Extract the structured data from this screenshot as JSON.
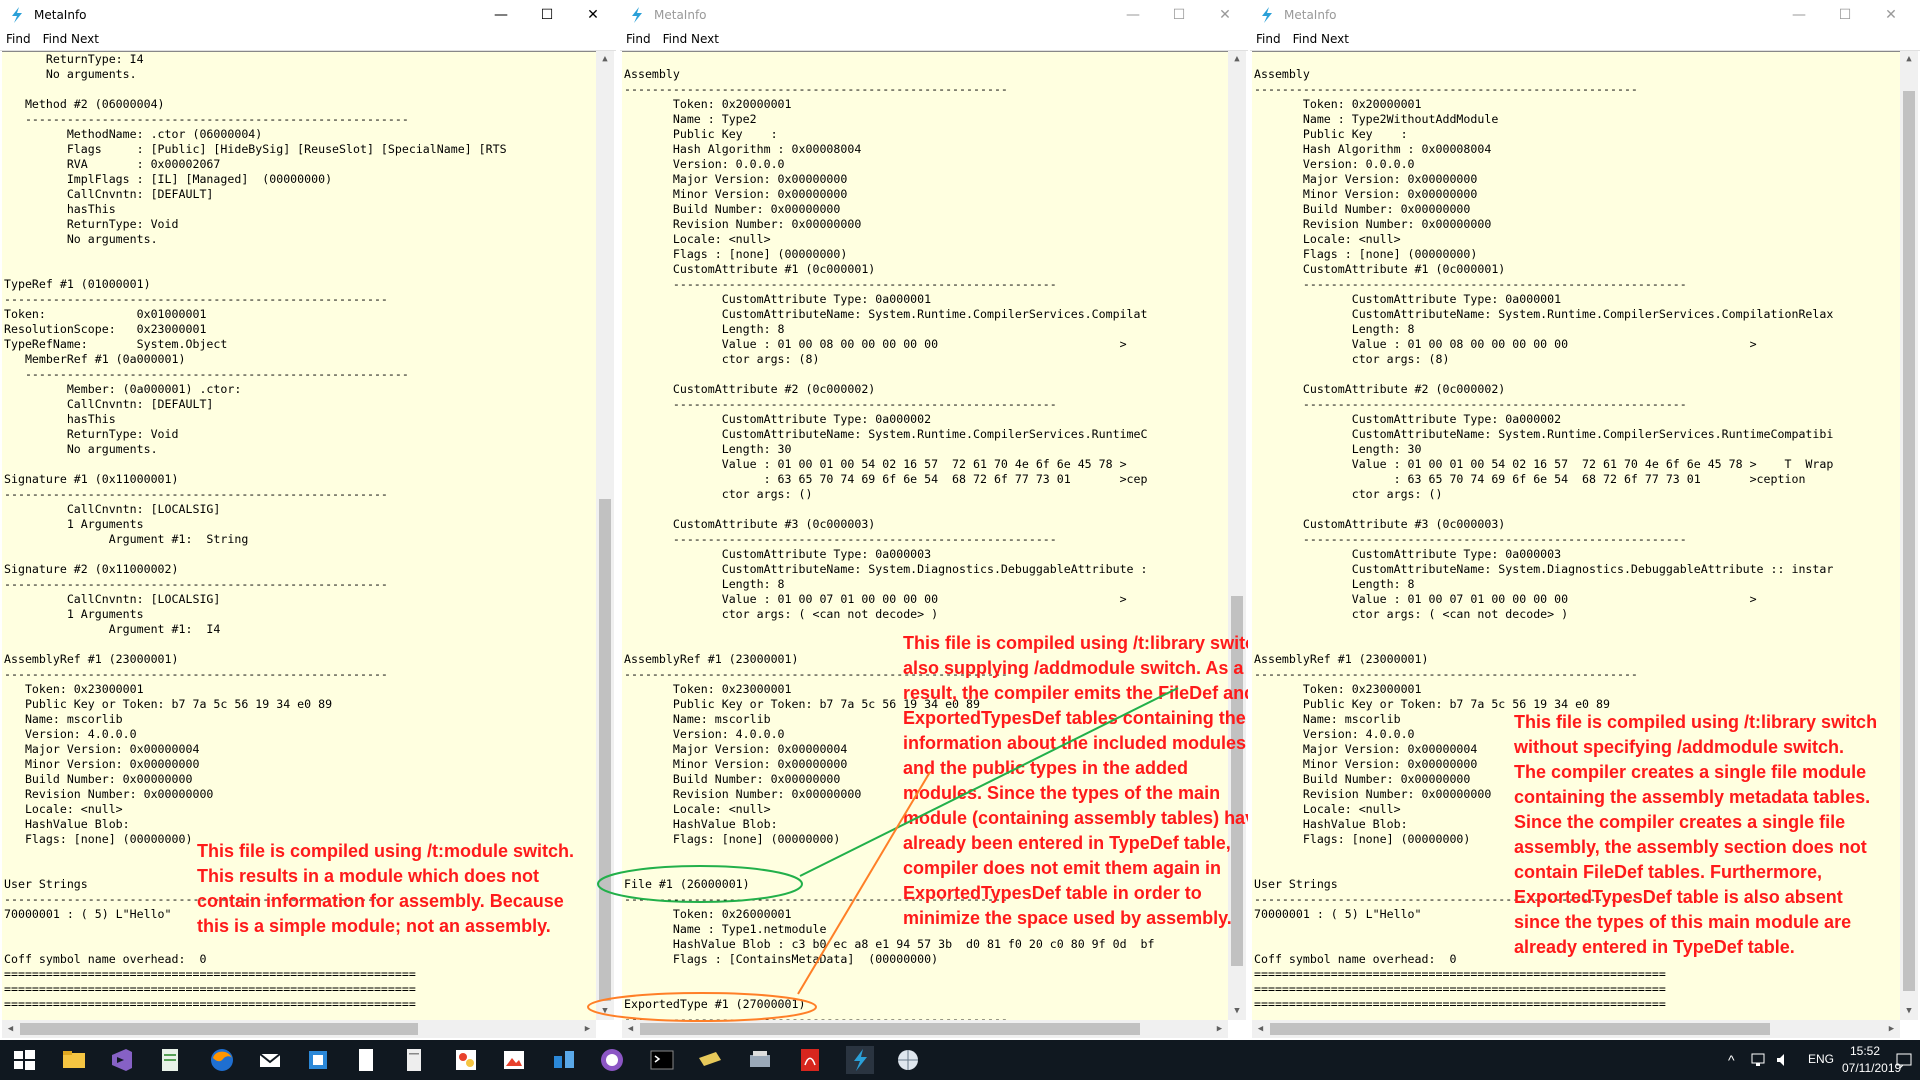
{
  "windows": [
    {
      "title": "MetaInfo",
      "menu": [
        "Find",
        "Find Next"
      ],
      "content": "      ReturnType: I4\n      No arguments.\n\n   Method #2 (06000004)\n   -------------------------------------------------------\n         MethodName: .ctor (06000004)\n         Flags     : [Public] [HideBySig] [ReuseSlot] [SpecialName] [RTS\n         RVA       : 0x00002067\n         ImplFlags : [IL] [Managed]  (00000000)\n         CallCnvntn: [DEFAULT]\n         hasThis\n         ReturnType: Void\n         No arguments.\n\n\nTypeRef #1 (01000001)\n-------------------------------------------------------\nToken:             0x01000001\nResolutionScope:   0x23000001\nTypeRefName:       System.Object\n   MemberRef #1 (0a000001)\n   -------------------------------------------------------\n         Member: (0a000001) .ctor:\n         CallCnvntn: [DEFAULT]\n         hasThis\n         ReturnType: Void\n         No arguments.\n\nSignature #1 (0x11000001)\n-------------------------------------------------------\n         CallCnvntn: [LOCALSIG]\n         1 Arguments\n               Argument #1:  String\n\nSignature #2 (0x11000002)\n-------------------------------------------------------\n         CallCnvntn: [LOCALSIG]\n         1 Arguments\n               Argument #1:  I4\n\nAssemblyRef #1 (23000001)\n-------------------------------------------------------\n   Token: 0x23000001\n   Public Key or Token: b7 7a 5c 56 19 34 e0 89\n   Name: mscorlib\n   Version: 4.0.0.0\n   Major Version: 0x00000004\n   Minor Version: 0x00000000\n   Build Number: 0x00000000\n   Revision Number: 0x00000000\n   Locale: <null>\n   HashValue Blob:\n   Flags: [none] (00000000)\n\n\nUser Strings\n-------------------------------------------------------\n70000001 : ( 5) L\"Hello\"\n\n\nCoff symbol name overhead:  0\n===========================================================\n===========================================================\n===========================================================",
      "annotation": "This file is compiled using /t:module switch.\nThis results in a module which does not\ncontain information for assembly. Because\nthis is a simple module; not an assembly."
    },
    {
      "title": "MetaInfo",
      "menu": [
        "Find",
        "Find Next"
      ],
      "content": "Assembly\n-------------------------------------------------------\n       Token: 0x20000001\n       Name : Type2\n       Public Key    :\n       Hash Algorithm : 0x00008004\n       Version: 0.0.0.0\n       Major Version: 0x00000000\n       Minor Version: 0x00000000\n       Build Number: 0x00000000\n       Revision Number: 0x00000000\n       Locale: <null>\n       Flags : [none] (00000000)\n       CustomAttribute #1 (0c000001)\n       -------------------------------------------------------\n              CustomAttribute Type: 0a000001\n              CustomAttributeName: System.Runtime.CompilerServices.Compilat\n              Length: 8\n              Value : 01 00 08 00 00 00 00 00                          >\n              ctor args: (8)\n\n       CustomAttribute #2 (0c000002)\n       -------------------------------------------------------\n              CustomAttribute Type: 0a000002\n              CustomAttributeName: System.Runtime.CompilerServices.RuntimeC\n              Length: 30\n              Value : 01 00 01 00 54 02 16 57  72 61 70 4e 6f 6e 45 78 >\n                    : 63 65 70 74 69 6f 6e 54  68 72 6f 77 73 01       >cep\n              ctor args: ()\n\n       CustomAttribute #3 (0c000003)\n       -------------------------------------------------------\n              CustomAttribute Type: 0a000003\n              CustomAttributeName: System.Diagnostics.DebuggableAttribute :\n              Length: 8\n              Value : 01 00 07 01 00 00 00 00                          >\n              ctor args: ( <can not decode> )\n\n\nAssemblyRef #1 (23000001)\n-------------------------------------------------------\n       Token: 0x23000001\n       Public Key or Token: b7 7a 5c 56 19 34 e0 89\n       Name: mscorlib\n       Version: 4.0.0.0\n       Major Version: 0x00000004\n       Minor Version: 0x00000000\n       Build Number: 0x00000000\n       Revision Number: 0x00000000\n       Locale: <null>\n       HashValue Blob:\n       Flags: [none] (00000000)\n\n\nFile #1 (26000001)\n-------------------------------------------------------\n       Token: 0x26000001\n       Name : Type1.netmodule\n       HashValue Blob : c3 b0 ec a8 e1 94 57 3b  d0 81 f0 20 c0 80 9f 0d  bf\n       Flags : [ContainsMetaData]  (00000000)\n\n\nExportedType #1 (27000001)\n-------------------------------------------------------",
      "annotation": "This file is compiled using /t:library switch\nalso supplying /addmodule switch. As a\nresult, the compiler emits the FileDef and\nExportedTypesDef tables containing the\ninformation about the included modules\nand the public types in the added\nmodules. Since the types of the main\nmodule (containing assembly tables) have\nalready been entered in TypeDef table,\ncompiler does not emit them again in\nExportedTypesDef table in order to\nminimize the space used by assembly."
    },
    {
      "title": "MetaInfo",
      "menu": [
        "Find",
        "Find Next"
      ],
      "content": "Assembly\n-------------------------------------------------------\n       Token: 0x20000001\n       Name : Type2WithoutAddModule\n       Public Key    :\n       Hash Algorithm : 0x00008004\n       Version: 0.0.0.0\n       Major Version: 0x00000000\n       Minor Version: 0x00000000\n       Build Number: 0x00000000\n       Revision Number: 0x00000000\n       Locale: <null>\n       Flags : [none] (00000000)\n       CustomAttribute #1 (0c000001)\n       -------------------------------------------------------\n              CustomAttribute Type: 0a000001\n              CustomAttributeName: System.Runtime.CompilerServices.CompilationRelax\n              Length: 8\n              Value : 01 00 08 00 00 00 00 00                          >\n              ctor args: (8)\n\n       CustomAttribute #2 (0c000002)\n       -------------------------------------------------------\n              CustomAttribute Type: 0a000002\n              CustomAttributeName: System.Runtime.CompilerServices.RuntimeCompatibi\n              Length: 30\n              Value : 01 00 01 00 54 02 16 57  72 61 70 4e 6f 6e 45 78 >    T  Wrap\n                    : 63 65 70 74 69 6f 6e 54  68 72 6f 77 73 01       >ception\n              ctor args: ()\n\n       CustomAttribute #3 (0c000003)\n       -------------------------------------------------------\n              CustomAttribute Type: 0a000003\n              CustomAttributeName: System.Diagnostics.DebuggableAttribute :: instar\n              Length: 8\n              Value : 01 00 07 01 00 00 00 00                          >\n              ctor args: ( <can not decode> )\n\n\nAssemblyRef #1 (23000001)\n-------------------------------------------------------\n       Token: 0x23000001\n       Public Key or Token: b7 7a 5c 56 19 34 e0 89\n       Name: mscorlib\n       Version: 4.0.0.0\n       Major Version: 0x00000004\n       Minor Version: 0x00000000\n       Build Number: 0x00000000\n       Revision Number: 0x00000000\n       Locale: <null>\n       HashValue Blob:\n       Flags: [none] (00000000)\n\n\nUser Strings\n-------------------------------------------------------\n70000001 : ( 5) L\"Hello\"\n\n\nCoff symbol name overhead:  0\n===========================================================\n===========================================================\n===========================================================",
      "annotation": "This file is compiled using /t:library switch\nwithout specifying /addmodule switch.\nThe compiler creates a single file module\ncontaining the assembly metadata tables.\nSince the compiler creates a single file\nassembly, the assembly section does not\ncontain FileDef tables. Furthermore,\nExportedTypesDef table is also absent\nsince the types of this main module are\nalready entered in TypeDef table."
    }
  ],
  "controls": {
    "minimize": "—",
    "maximize": "☐",
    "close": "✕"
  },
  "taskbar": {
    "icons": [
      "windows-start",
      "file-explorer",
      "visual-studio",
      "notepad",
      "firefox",
      "mail",
      "app-blue",
      "document",
      "document-white",
      "paint",
      "photos",
      "network-app",
      "purple-app",
      "terminal",
      "folder-yellow",
      "scanner",
      "acrobat",
      "metainfo",
      "globe-tool"
    ],
    "time": "15:52",
    "date": "07/11/2019"
  },
  "colors": {
    "annotation": "#ff1a1a",
    "circle_green": "#22b04a",
    "circle_orange": "#ff7f27",
    "content_bg": "#ffffe0"
  }
}
